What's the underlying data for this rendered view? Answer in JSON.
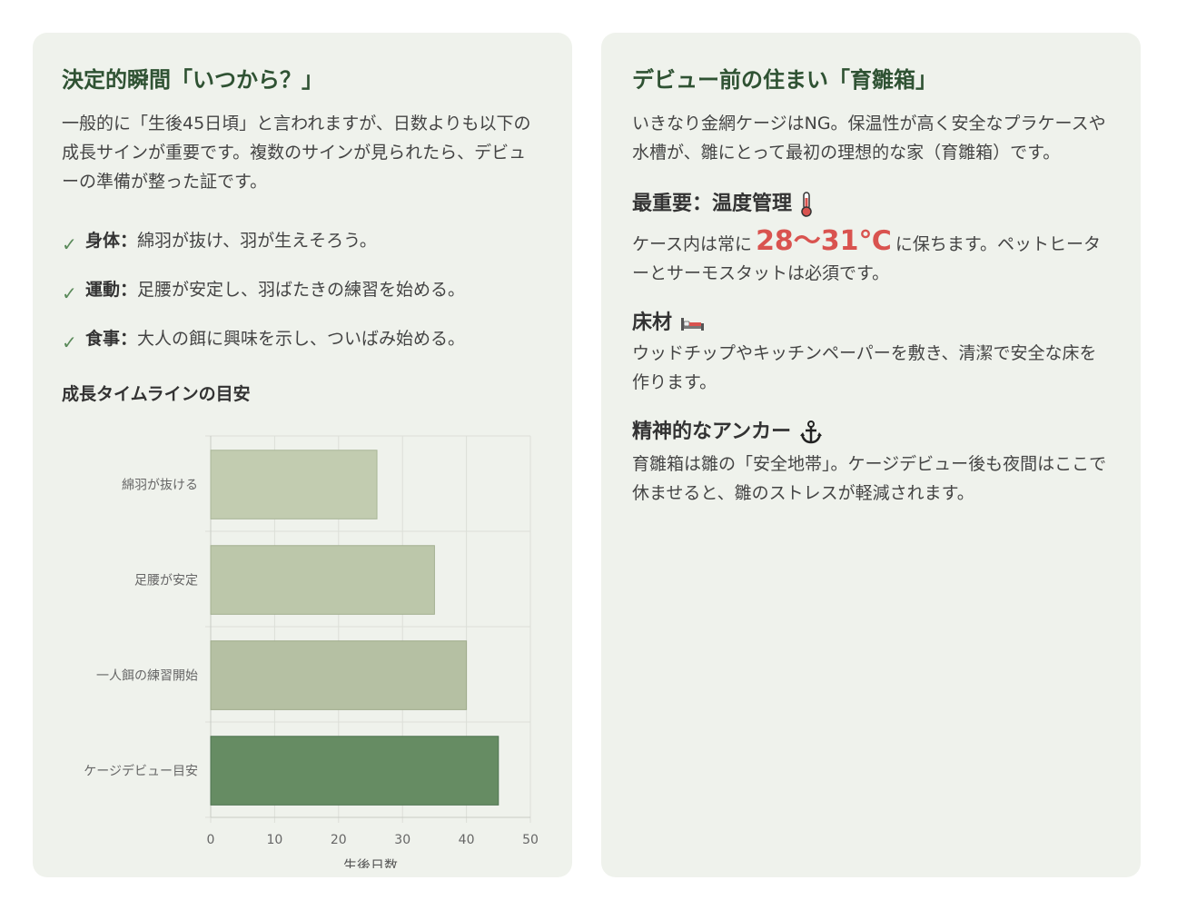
{
  "left": {
    "title": "決定的瞬間「いつから？」",
    "intro": "一般的に「生後45日頃」と言われますが、日数よりも以下の成長サインが重要です。複数のサインが見られたら、デビューの準備が整った証です。",
    "check_mark": "✓",
    "signs": [
      {
        "key": "身体：",
        "text": "綿羽が抜け、羽が生えそろう。"
      },
      {
        "key": "運動：",
        "text": "足腰が安定し、羽ばたきの練習を始める。"
      },
      {
        "key": "食事：",
        "text": "大人の餌に興味を示し、ついばみ始める。"
      }
    ],
    "chart_heading": "成長タイムラインの目安"
  },
  "chart_data": {
    "type": "bar",
    "orientation": "horizontal",
    "categories": [
      "綿羽が抜ける",
      "足腰が安定",
      "一人餌の練習開始",
      "ケージデビュー目安"
    ],
    "values": [
      26,
      35,
      40,
      45
    ],
    "xlabel": "生後日数",
    "ylabel": "",
    "xlim": [
      0,
      50
    ],
    "xticks": [
      0,
      10,
      20,
      30,
      40,
      50
    ],
    "grid": true,
    "colors": [
      "#c2ccb0",
      "#bcc7aa",
      "#b5c0a3",
      "#668c63"
    ],
    "border_colors": [
      "#a9b697",
      "#a3b090",
      "#9daa8a",
      "#4e7350"
    ]
  },
  "right": {
    "title": "デビュー前の住まい「育雛箱」",
    "intro": "いきなり金網ケージはNG。保温性が高く安全なプラケースや水槽が、雛にとって最初の理想的な家（育雛箱）です。",
    "sections": {
      "temp": {
        "heading": "最重要：温度管理",
        "icon": "thermometer-icon",
        "pre": "ケース内は常に",
        "value": "28〜31℃",
        "post": "に保ちます。ペットヒーターとサーモスタットは必須です。"
      },
      "floor": {
        "heading": "床材",
        "icon": "bed-icon",
        "body": "ウッドチップやキッチンペーパーを敷き、清潔で安全な床を作ります。"
      },
      "anchor": {
        "heading": "精神的なアンカー",
        "icon": "anchor-icon",
        "body": "育雛箱は雛の「安全地帯」。ケージデビュー後も夜間はここで休ませると、雛のストレスが軽減されます。"
      }
    },
    "accent_color": "#d9534f"
  }
}
